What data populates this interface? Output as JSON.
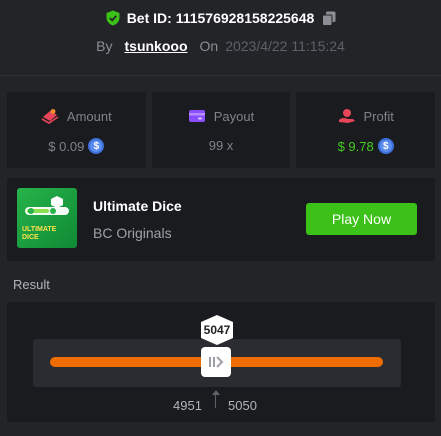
{
  "header": {
    "bet_id_label": "Bet ID: 111576928158225648",
    "by_label": "By",
    "username": "tsunkooo",
    "on_label": "On",
    "timestamp": "2023/4/22 11:15:24"
  },
  "stats": {
    "amount": {
      "label": "Amount",
      "value": "$ 0.09",
      "icon": "money-stack-icon",
      "coin": "coin-icon"
    },
    "payout": {
      "label": "Payout",
      "value": "99 x",
      "icon": "wallet-icon"
    },
    "profit": {
      "label": "Profit",
      "value": "$ 9.78",
      "icon": "profit-icon",
      "coin": "coin-icon"
    }
  },
  "game": {
    "title": "Ultimate Dice",
    "provider": "BC Originals",
    "thumb_text_line1": "ULTIMATE",
    "thumb_text_line2": "DICE",
    "play_label": "Play Now"
  },
  "result": {
    "label": "Result",
    "rolled": "5047",
    "range_low": "4951",
    "range_high": "5050"
  },
  "colors": {
    "accent_green": "#3bc117",
    "profit_green": "#44cc22",
    "track_orange": "#ef6d00",
    "coin_blue": "#5b8def"
  }
}
